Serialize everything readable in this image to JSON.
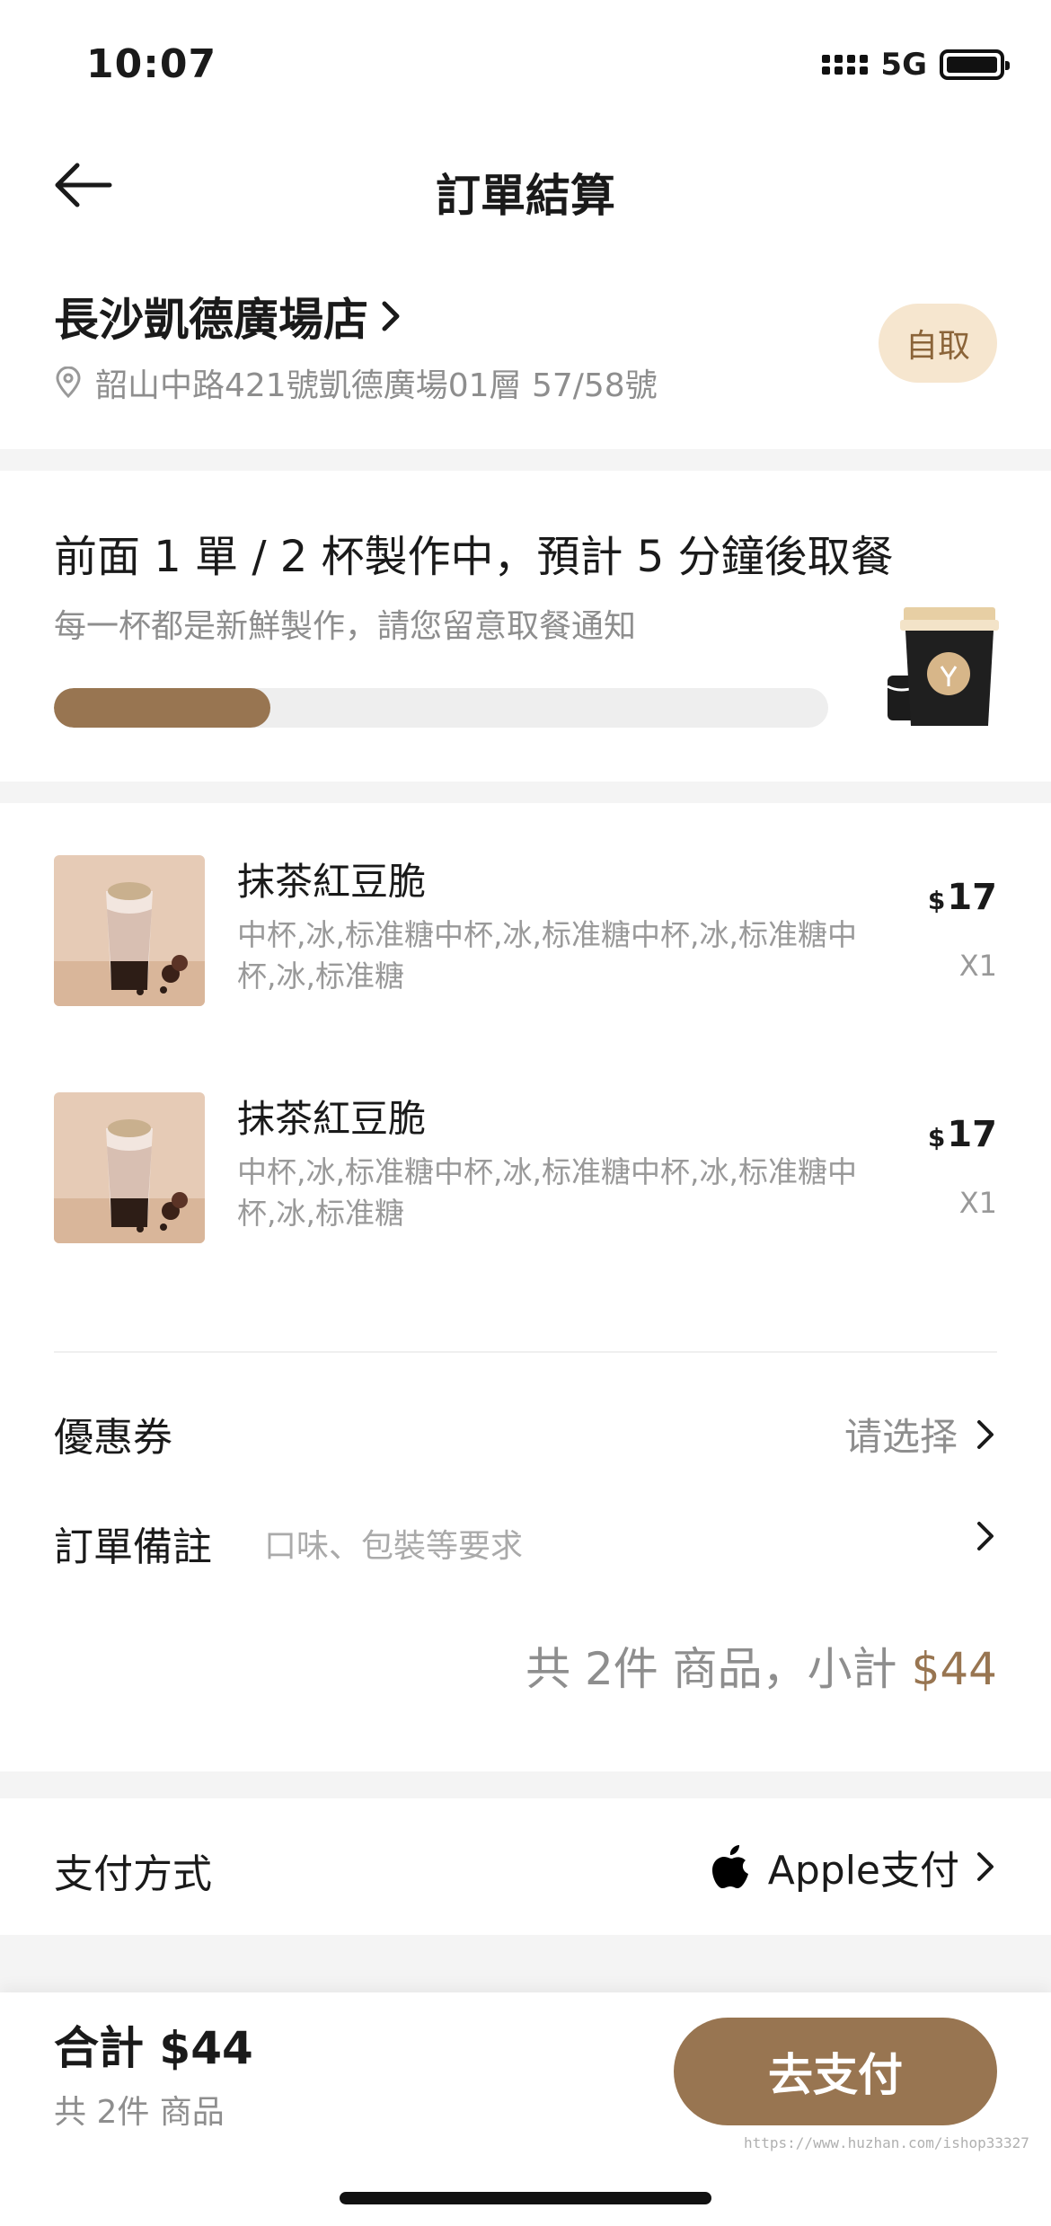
{
  "status_bar": {
    "time": "10:07",
    "network": "5G"
  },
  "header": {
    "title": "訂單結算"
  },
  "store": {
    "name": "長沙凱德廣場店",
    "address": "韶山中路421號凱德廣場01層 57/58號",
    "mode": "自取"
  },
  "queue": {
    "title": "前面 1 單 / 2 杯製作中，預計 5 分鐘後取餐",
    "subtitle": "每一杯都是新鮮製作，請您留意取餐通知",
    "progress": 0.28
  },
  "items": [
    {
      "name": "抹茶紅豆脆",
      "options": "中杯,冰,标准糖中杯,冰,标准糖中杯,冰,标准糖中杯,冰,标准糖",
      "currency": "$",
      "price": "17",
      "qty": "X1"
    },
    {
      "name": "抹茶紅豆脆",
      "options": "中杯,冰,标准糖中杯,冰,标准糖中杯,冰,标准糖中杯,冰,标准糖",
      "currency": "$",
      "price": "17",
      "qty": "X1"
    }
  ],
  "coupon": {
    "label": "優惠券",
    "value": "请选择"
  },
  "note": {
    "label": "訂單備註",
    "placeholder": "口味、包裝等要求"
  },
  "summary": {
    "text": "共 2件 商品，小計 ",
    "amount": "$44"
  },
  "payment": {
    "label": "支付方式",
    "method": "Apple支付"
  },
  "checkout": {
    "total": "合計 $44",
    "count": "共 2件 商品",
    "button": "去支付",
    "watermark": "https://www.huzhan.com/ishop33327"
  },
  "colors": {
    "accent": "#987551",
    "badge_bg": "#f6e6cf",
    "badge_text": "#8b6439"
  }
}
